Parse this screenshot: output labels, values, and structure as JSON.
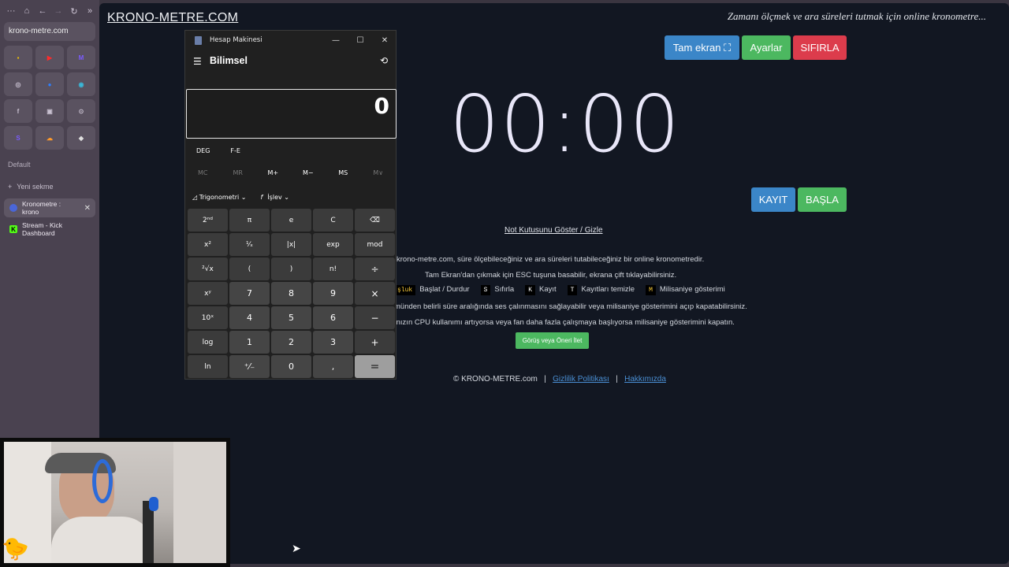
{
  "browser": {
    "nav": {
      "menu": "···",
      "home": "⌂",
      "back": "←",
      "forward": "→",
      "reload": "↻",
      "more": "»"
    },
    "url": "krono-metre.com",
    "space_label": "Default",
    "new_tab_label": "Yeni sekme",
    "tabs": [
      {
        "title": "Kronometre : krono",
        "active": true,
        "favicon_color": "#4a66d8"
      },
      {
        "title": "Stream - Kick Dashboard",
        "active": false,
        "favicon_color": "#53fc18"
      }
    ],
    "pinned": [
      {
        "glyph": "▪",
        "color": "#f2c200"
      },
      {
        "glyph": "▶",
        "color": "#ff2b2b"
      },
      {
        "glyph": "M",
        "color": "#7b5cff"
      },
      {
        "glyph": "◎",
        "color": "#c8c0d0"
      },
      {
        "glyph": "●",
        "color": "#2d7fff"
      },
      {
        "glyph": "◉",
        "color": "#3ab8d8"
      },
      {
        "glyph": "f",
        "color": "#c8c0d0"
      },
      {
        "glyph": "▣",
        "color": "#c8c0d0"
      },
      {
        "glyph": "⊙",
        "color": "#c8c0d0"
      },
      {
        "glyph": "S",
        "color": "#7b5cff"
      },
      {
        "glyph": "☁",
        "color": "#ff9a2b"
      },
      {
        "glyph": "◆",
        "color": "#e0e0e0"
      }
    ]
  },
  "site": {
    "title": "KRONO-METRE.COM",
    "tagline": "Zamanı ölçmek ve ara süreleri tutmak için online kronometre...",
    "buttons": {
      "fullscreen": "Tam ekran ⛶",
      "settings": "Ayarlar",
      "reset": "SIFIRLA",
      "record": "KAYIT",
      "start": "BAŞLA"
    },
    "timer": "00:00",
    "notes_link": "Not Kutusunu Göster / Gizle",
    "info_lines": [
      "krono-metre.com, süre ölçebileceğiniz ve ara süreleri tutabileceğiniz bir online kronometredir.",
      "Tam Ekran'dan çıkmak için ESC tuşuna basabilir, ekrana çift tıklayabilirsiniz.",
      "münden belirli süre aralığında ses çalınmasını sağlayabilir veya milisaniye gösterimini açıp kapatabilirsiniz.",
      "ınızın CPU kullanımı artıyorsa veya fan daha fazla çalışmaya başlıyorsa milisaniye gösterimini kapatın."
    ],
    "shortcuts": [
      {
        "key": "şluk",
        "label": "Başlat / Durdur"
      },
      {
        "key": "S",
        "label": "Sıfırla"
      },
      {
        "key": "K",
        "label": "Kayıt"
      },
      {
        "key": "T",
        "label": "Kayıtları temizle"
      },
      {
        "key": "M",
        "label": "Milisaniye gösterimi"
      }
    ],
    "feedback": "Görüş veya Öneri İlet",
    "footer": {
      "copyright": "© KRONO-METRE.com",
      "sep": "|",
      "privacy": "Gizlilik Politikası",
      "about": "Hakkımızda"
    },
    "colors": {
      "blue": "#3b86c8",
      "green": "#4cb860",
      "red": "#dc3c4c",
      "bg": "#121722"
    }
  },
  "calculator": {
    "window_title": "Hesap Makinesi",
    "controls": {
      "minimize": "—",
      "maximize": "☐",
      "close": "✕"
    },
    "mode": "Bilimsel",
    "display": "0",
    "angle": {
      "deg": "DEG",
      "fe": "F-E"
    },
    "memory": [
      {
        "label": "MC",
        "enabled": false
      },
      {
        "label": "MR",
        "enabled": false
      },
      {
        "label": "M+",
        "enabled": true
      },
      {
        "label": "M−",
        "enabled": true
      },
      {
        "label": "MS",
        "enabled": true
      },
      {
        "label": "M∨",
        "enabled": false
      }
    ],
    "functions": {
      "trig": "Trigonometri",
      "func": "İşlev"
    },
    "keys": [
      {
        "label": "2ⁿᵈ",
        "type": "fn"
      },
      {
        "label": "π",
        "type": "fn"
      },
      {
        "label": "e",
        "type": "fn"
      },
      {
        "label": "C",
        "type": "fn"
      },
      {
        "label": "⌫",
        "type": "fn"
      },
      {
        "label": "x²",
        "type": "fn"
      },
      {
        "label": "¹⁄ₓ",
        "type": "fn"
      },
      {
        "label": "|x|",
        "type": "fn"
      },
      {
        "label": "exp",
        "type": "fn"
      },
      {
        "label": "mod",
        "type": "fn"
      },
      {
        "label": "²√x",
        "type": "fn"
      },
      {
        "label": "(",
        "type": "fn"
      },
      {
        "label": ")",
        "type": "fn"
      },
      {
        "label": "n!",
        "type": "fn"
      },
      {
        "label": "÷",
        "type": "op"
      },
      {
        "label": "xʸ",
        "type": "fn"
      },
      {
        "label": "7",
        "type": "num"
      },
      {
        "label": "8",
        "type": "num"
      },
      {
        "label": "9",
        "type": "num"
      },
      {
        "label": "×",
        "type": "op"
      },
      {
        "label": "10ˣ",
        "type": "fn"
      },
      {
        "label": "4",
        "type": "num"
      },
      {
        "label": "5",
        "type": "num"
      },
      {
        "label": "6",
        "type": "num"
      },
      {
        "label": "−",
        "type": "op"
      },
      {
        "label": "log",
        "type": "fn"
      },
      {
        "label": "1",
        "type": "num"
      },
      {
        "label": "2",
        "type": "num"
      },
      {
        "label": "3",
        "type": "num"
      },
      {
        "label": "+",
        "type": "op"
      },
      {
        "label": "ln",
        "type": "fn"
      },
      {
        "label": "⁺⁄₋",
        "type": "num"
      },
      {
        "label": "0",
        "type": "num"
      },
      {
        "label": ",",
        "type": "num"
      },
      {
        "label": "=",
        "type": "eq"
      }
    ]
  }
}
